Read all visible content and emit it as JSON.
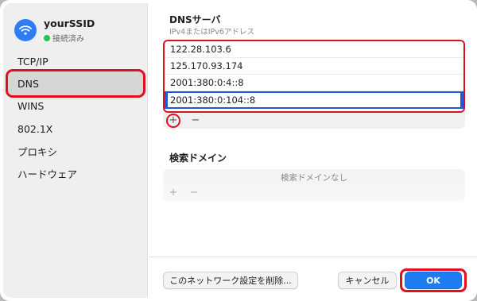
{
  "sidebar": {
    "network_name": "yourSSID",
    "network_status": "接続済み",
    "items": [
      {
        "label": "TCP/IP"
      },
      {
        "label": "DNS"
      },
      {
        "label": "WINS"
      },
      {
        "label": "802.1X"
      },
      {
        "label": "プロキシ"
      },
      {
        "label": "ハードウェア"
      }
    ]
  },
  "dns": {
    "title": "DNSサーバ",
    "subtitle": "IPv4またはIPv6アドレス",
    "servers": [
      "122.28.103.6",
      "125.170.93.174",
      "2001:380:0:4::8"
    ],
    "editing_value": "2001:380:0:104::8",
    "add_label": "+",
    "remove_label": "−"
  },
  "search_domain": {
    "title": "検索ドメイン",
    "empty_text": "検索ドメインなし",
    "add_label": "+",
    "remove_label": "−"
  },
  "footer": {
    "delete_label": "このネットワーク設定を削除...",
    "cancel_label": "キャンセル",
    "ok_label": "OK"
  },
  "colors": {
    "highlight": "#e01020",
    "accent": "#1e7cf2",
    "selection": "#1f5bd8",
    "status_ok": "#2ac14e"
  }
}
